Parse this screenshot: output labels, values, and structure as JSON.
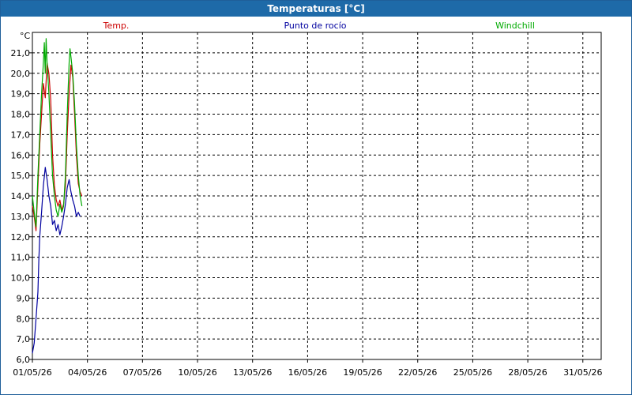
{
  "window": {
    "title": "Temperaturas [°C]"
  },
  "chart_data": {
    "type": "line",
    "title": "Temperaturas [°C]",
    "y_unit_label": "°C",
    "ylim": [
      6.0,
      22.0
    ],
    "yticks": [
      "6,0",
      "7,0",
      "8,0",
      "9,0",
      "10,0",
      "11,0",
      "12,0",
      "13,0",
      "14,0",
      "15,0",
      "16,0",
      "17,0",
      "18,0",
      "19,0",
      "20,0",
      "21,0"
    ],
    "xlim": [
      0,
      31
    ],
    "xticks": [
      "01/05/26",
      "04/05/26",
      "07/05/26",
      "10/05/26",
      "13/05/26",
      "16/05/26",
      "19/05/26",
      "22/05/26",
      "25/05/26",
      "28/05/26",
      "31/05/26"
    ],
    "grid": true,
    "legend_position": "top",
    "series": [
      {
        "name": "Temp.",
        "color": "#cc0000",
        "points": [
          [
            0.0,
            13.5
          ],
          [
            0.1,
            13.0
          ],
          [
            0.2,
            12.3
          ],
          [
            0.3,
            14.5
          ],
          [
            0.4,
            16.5
          ],
          [
            0.5,
            18.0
          ],
          [
            0.6,
            19.5
          ],
          [
            0.7,
            18.8
          ],
          [
            0.8,
            20.5
          ],
          [
            0.9,
            20.0
          ],
          [
            1.0,
            18.7
          ],
          [
            1.1,
            16.0
          ],
          [
            1.2,
            14.5
          ],
          [
            1.3,
            13.8
          ],
          [
            1.4,
            13.5
          ],
          [
            1.5,
            13.8
          ],
          [
            1.6,
            13.3
          ],
          [
            1.7,
            13.6
          ],
          [
            1.8,
            14.5
          ],
          [
            1.9,
            17.0
          ],
          [
            2.0,
            19.0
          ],
          [
            2.1,
            20.4
          ],
          [
            2.2,
            19.8
          ],
          [
            2.3,
            18.0
          ],
          [
            2.4,
            16.0
          ],
          [
            2.5,
            14.6
          ],
          [
            2.6,
            14.2
          ],
          [
            2.7,
            14.0
          ]
        ]
      },
      {
        "name": "Punto de rocío",
        "color": "#00009f",
        "points": [
          [
            0.0,
            6.3
          ],
          [
            0.1,
            6.8
          ],
          [
            0.2,
            8.0
          ],
          [
            0.3,
            9.3
          ],
          [
            0.35,
            10.8
          ],
          [
            0.4,
            12.0
          ],
          [
            0.5,
            13.2
          ],
          [
            0.6,
            14.5
          ],
          [
            0.7,
            15.4
          ],
          [
            0.8,
            14.8
          ],
          [
            0.9,
            14.0
          ],
          [
            1.0,
            13.5
          ],
          [
            1.1,
            12.6
          ],
          [
            1.2,
            12.8
          ],
          [
            1.3,
            12.3
          ],
          [
            1.4,
            12.6
          ],
          [
            1.5,
            12.1
          ],
          [
            1.6,
            12.5
          ],
          [
            1.7,
            13.0
          ],
          [
            1.8,
            13.6
          ],
          [
            1.9,
            14.4
          ],
          [
            2.0,
            14.8
          ],
          [
            2.1,
            14.2
          ],
          [
            2.2,
            13.8
          ],
          [
            2.3,
            13.5
          ],
          [
            2.4,
            13.0
          ],
          [
            2.5,
            13.2
          ],
          [
            2.6,
            13.0
          ]
        ]
      },
      {
        "name": "Windchill",
        "color": "#00aa00",
        "points": [
          [
            0.0,
            14.0
          ],
          [
            0.1,
            13.2
          ],
          [
            0.2,
            12.5
          ],
          [
            0.3,
            15.0
          ],
          [
            0.4,
            17.0
          ],
          [
            0.5,
            19.0
          ],
          [
            0.6,
            20.5
          ],
          [
            0.65,
            21.5
          ],
          [
            0.7,
            20.0
          ],
          [
            0.75,
            21.7
          ],
          [
            0.8,
            20.5
          ],
          [
            0.9,
            19.0
          ],
          [
            1.0,
            17.0
          ],
          [
            1.1,
            15.0
          ],
          [
            1.2,
            14.0
          ],
          [
            1.3,
            13.3
          ],
          [
            1.4,
            13.0
          ],
          [
            1.5,
            13.6
          ],
          [
            1.6,
            13.2
          ],
          [
            1.7,
            13.5
          ],
          [
            1.8,
            15.0
          ],
          [
            1.9,
            18.0
          ],
          [
            2.0,
            20.5
          ],
          [
            2.05,
            21.2
          ],
          [
            2.1,
            20.8
          ],
          [
            2.2,
            20.0
          ],
          [
            2.3,
            18.5
          ],
          [
            2.4,
            16.5
          ],
          [
            2.5,
            15.0
          ],
          [
            2.6,
            14.0
          ],
          [
            2.7,
            13.5
          ]
        ]
      }
    ]
  }
}
